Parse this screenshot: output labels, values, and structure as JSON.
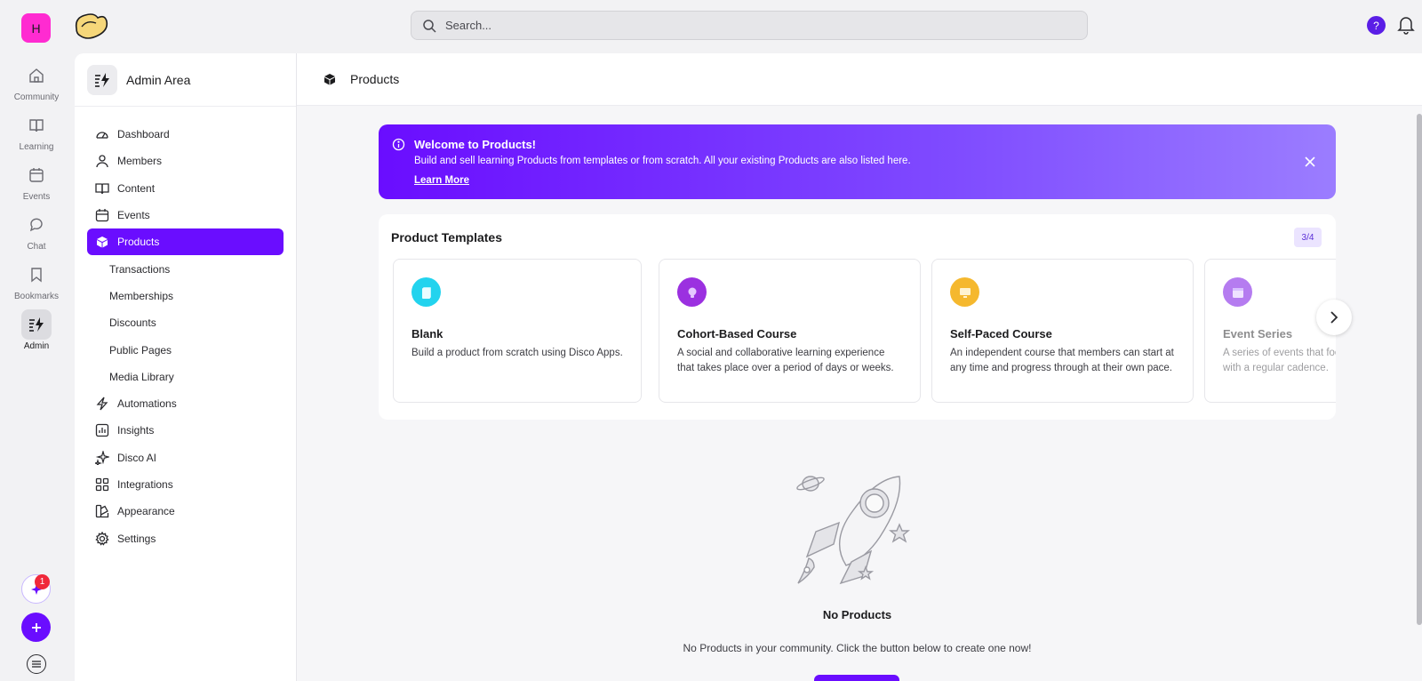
{
  "rail": {
    "avatar_letter": "H",
    "items": [
      {
        "label": "Community",
        "icon": "home-icon"
      },
      {
        "label": "Learning",
        "icon": "book-icon"
      },
      {
        "label": "Events",
        "icon": "calendar-icon"
      },
      {
        "label": "Chat",
        "icon": "chat-icon"
      },
      {
        "label": "Bookmarks",
        "icon": "bookmark-icon"
      },
      {
        "label": "Admin",
        "icon": "admin-bolt-icon"
      }
    ],
    "notification_count": "1"
  },
  "topbar": {
    "search_placeholder": "Search...",
    "help_label": "?"
  },
  "admin": {
    "title": "Admin Area",
    "nav": [
      {
        "label": "Dashboard",
        "icon": "dashboard-icon"
      },
      {
        "label": "Members",
        "icon": "user-icon"
      },
      {
        "label": "Content",
        "icon": "book-open-icon"
      },
      {
        "label": "Events",
        "icon": "calendar-icon"
      },
      {
        "label": "Products",
        "icon": "cube-icon"
      }
    ],
    "sub": [
      "Transactions",
      "Memberships",
      "Discounts",
      "Public Pages",
      "Media Library"
    ],
    "nav2": [
      {
        "label": "Automations",
        "icon": "lightning-icon"
      },
      {
        "label": "Insights",
        "icon": "chart-icon"
      },
      {
        "label": "Disco AI",
        "icon": "sparkle-icon"
      },
      {
        "label": "Integrations",
        "icon": "grid-icon"
      },
      {
        "label": "Appearance",
        "icon": "palette-icon"
      },
      {
        "label": "Settings",
        "icon": "gear-icon"
      }
    ]
  },
  "main": {
    "title": "Products",
    "banner": {
      "title": "Welcome to Products!",
      "text": "Build and sell learning Products from templates or from scratch. All your existing Products are also listed here.",
      "link": "Learn More"
    },
    "templates": {
      "title": "Product Templates",
      "count": "3/4",
      "cards": [
        {
          "name": "Blank",
          "desc": "Build a product from scratch using Disco Apps.",
          "color": "#22d3ee"
        },
        {
          "name": "Cohort-Based Course",
          "desc": "A social and collaborative learning experience that takes place over a period of days or weeks.",
          "color": "#9b30e0"
        },
        {
          "name": "Self-Paced Course",
          "desc": "An independent course that members can start at any time and progress through at their own pace.",
          "color": "#f5b82e"
        },
        {
          "name": "Event Series",
          "desc": "A series of events that focus on a topic and occur with a regular cadence.",
          "color": "#b57cf0"
        }
      ]
    },
    "empty": {
      "title": "No Products",
      "text": "No Products in your community. Click the button below to create one now!"
    }
  },
  "colors": {
    "accent": "#6a0dff",
    "avatar": "#ff2bd1",
    "badge": "#f0283a"
  }
}
